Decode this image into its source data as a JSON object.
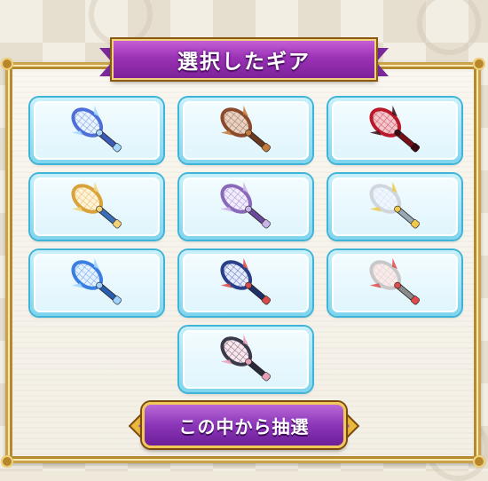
{
  "title": "選択したギア",
  "draw_button_label": "この中から抽選",
  "gears": [
    {
      "name": "racket-blue-wings",
      "frame": "#4e6fd8",
      "accent": "#a7d8ff",
      "handle": "#3c5bb8",
      "strings": "#e8f4ff"
    },
    {
      "name": "racket-bronze-spikes",
      "frame": "#8b4a2b",
      "accent": "#c47a3a",
      "handle": "#6a3a1f",
      "strings": "#e6d2c2"
    },
    {
      "name": "racket-crimson-dragon",
      "frame": "#b81a2a",
      "accent": "#3a0a10",
      "handle": "#7a0e18",
      "strings": "#f3c6cc"
    },
    {
      "name": "racket-gold-classic",
      "frame": "#d9a23a",
      "accent": "#f3d27a",
      "handle": "#3a6fb8",
      "strings": "#fff3d6"
    },
    {
      "name": "racket-purple-bat",
      "frame": "#8a6ab8",
      "accent": "#c9b3e8",
      "handle": "#6a4a9a",
      "strings": "#f2ecff"
    },
    {
      "name": "racket-white-floral",
      "frame": "#cfd6dc",
      "accent": "#f0c84a",
      "handle": "#9aa8b4",
      "strings": "#eef6ff"
    },
    {
      "name": "racket-blue-crystal",
      "frame": "#3a7fe0",
      "accent": "#9fd3ff",
      "handle": "#2a5cb0",
      "strings": "#e4f2ff"
    },
    {
      "name": "racket-navy-royal",
      "frame": "#2a3f8a",
      "accent": "#d94a4a",
      "handle": "#1e2f6a",
      "strings": "#e6ecff"
    },
    {
      "name": "racket-red-ribbon",
      "frame": "#c8c8c8",
      "accent": "#e04a4a",
      "handle": "#8a8a8a",
      "strings": "#fbeaea"
    },
    {
      "name": "racket-dark-heart",
      "frame": "#3a3a4a",
      "accent": "#e8a0b8",
      "handle": "#2a2a3a",
      "strings": "#fbe6ee"
    }
  ]
}
